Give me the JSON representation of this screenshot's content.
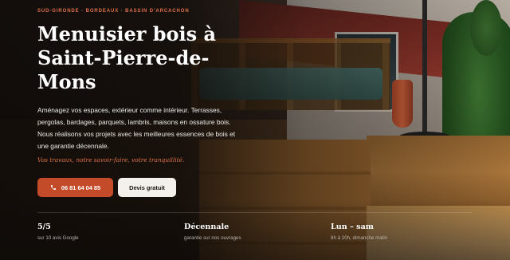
{
  "hero": {
    "eyebrow": "SUD-GIRONDE · BORDEAUX · BASSIN D'ARCACHON",
    "title": "Menuisier bois à Saint-Pierre-de-Mons",
    "lead": "Aménagez vos espaces, extérieur comme intérieur. Terrasses, pergolas, bardages, parquets, lambris, maisons en ossature bois. Nous réalisons vos projets avec les meilleures essences de bois et une garantie décennale.",
    "tagline": "Vos travaux, notre savoir-faire, votre tranquillité.",
    "call_button": {
      "label": "06 81 64 04 85",
      "icon": "phone-icon"
    },
    "quote_button": {
      "label": "Devis gratuit"
    }
  },
  "stats": [
    {
      "value": "5/5",
      "label": "sur 10 avis Google"
    },
    {
      "value": "Décennale",
      "label": "garantie sur nos ouvrages"
    },
    {
      "value": "Lun – sam",
      "label": "8h à 20h, dimanche matin"
    }
  ],
  "colors": {
    "accent": "#e07048",
    "button_primary": "#c44b2a",
    "button_secondary": "#f4f1ec"
  }
}
